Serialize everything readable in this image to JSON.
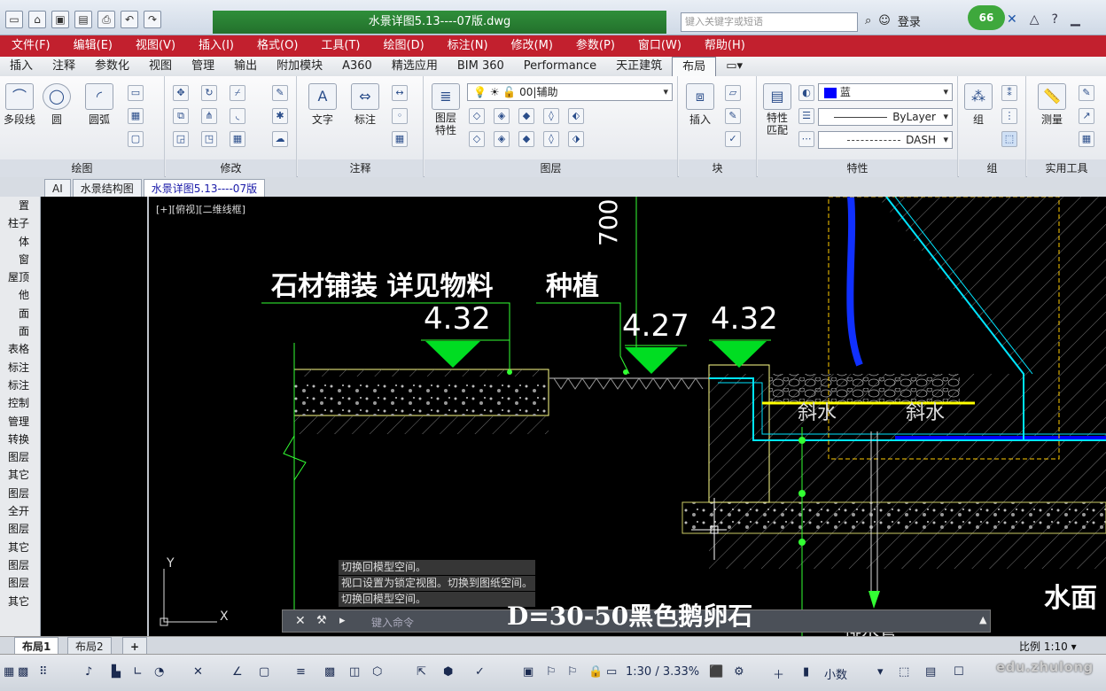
{
  "title_bar": {
    "document_title": "水景详图5.13----07版.dwg",
    "search_placeholder": "键入关键字或短语",
    "login_label": "登录",
    "badge_count": "66"
  },
  "quick_access": [
    "new-file-icon",
    "open-folder-icon",
    "save-icon",
    "save-as-icon",
    "print-icon",
    "undo-icon",
    "redo-icon"
  ],
  "menu": [
    "文件(F)",
    "编辑(E)",
    "视图(V)",
    "插入(I)",
    "格式(O)",
    "工具(T)",
    "绘图(D)",
    "标注(N)",
    "修改(M)",
    "参数(P)",
    "窗口(W)",
    "帮助(H)"
  ],
  "ribbon_tabs": [
    "插入",
    "注释",
    "参数化",
    "视图",
    "管理",
    "输出",
    "附加模块",
    "A360",
    "精选应用",
    "BIM 360",
    "Performance",
    "天正建筑",
    "布局"
  ],
  "ribbon_active_tab": "布局",
  "panels": {
    "draw": {
      "title": "绘图",
      "polyline": "多段线",
      "circle": "圆",
      "arc": "圆弧"
    },
    "modify": {
      "title": "修改"
    },
    "annotation": {
      "title": "注释",
      "text": "文字",
      "dimension": "标注"
    },
    "layers": {
      "title": "图层",
      "layer_props": "图层\n特性",
      "current_layer": "00|辅助"
    },
    "block": {
      "title": "块",
      "insert": "插入"
    },
    "properties": {
      "title": "特性",
      "match": "特性\n匹配",
      "color": "蓝",
      "linetype": "ByLayer",
      "lineweight": "DASH"
    },
    "groups": {
      "title": "组",
      "group": "组"
    },
    "utilities": {
      "title": "实用工具",
      "measure": "测量"
    }
  },
  "doc_tabs": [
    "AI",
    "水景结构图",
    "水景详图5.13----07版"
  ],
  "doc_tab_active": 2,
  "left_palette": [
    "置",
    "柱子",
    "体",
    "窗",
    "屋顶",
    "他",
    "面",
    "面",
    "表格",
    "标注",
    "标注",
    "控制",
    "管理",
    "转换",
    "图层",
    "其它",
    "图层",
    "全开",
    "图层",
    "其它",
    "图层",
    "图层",
    "其它"
  ],
  "viewport_label": "[+][俯视][二维线框]",
  "drawing_text": {
    "label1": "石材铺装 详见物料",
    "label2": "种植",
    "dim_700": "700",
    "elev1": "4.32",
    "elev2": "4.27",
    "elev3": "4.32",
    "slope1": "斜水",
    "slope2": "斜水",
    "bottom_note": "D=30-50黑色鹅卵石",
    "water_surface": "水面",
    "drain": "排水管"
  },
  "command_history": [
    "切换回模型空间。",
    "视口设置为锁定视图。切换到图纸空间。",
    "切换回模型空间。"
  ],
  "command_placeholder": "键入命令",
  "layout_tabs": [
    "布局1",
    "布局2"
  ],
  "layout_active": 0,
  "scale_label": "比例 1:10",
  "status": {
    "scale": "1:30 / 3.33%",
    "units": "小数"
  },
  "watermark": "edu.zhulong"
}
